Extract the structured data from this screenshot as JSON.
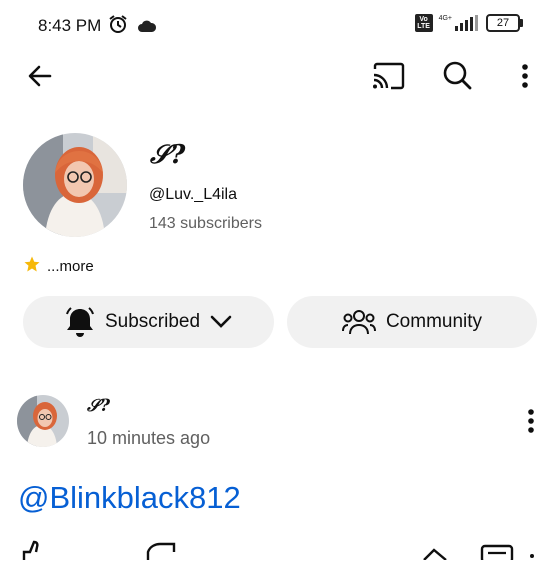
{
  "status_bar": {
    "time": "8:43 PM",
    "volte": "Vo LTE",
    "network": "4G+",
    "battery": "27"
  },
  "channel": {
    "name": "𝒮?",
    "handle": "@Luv._L4ila",
    "subscribers": "143 subscribers",
    "description_more": "...more"
  },
  "buttons": {
    "subscribed": "Subscribed",
    "community": "Community"
  },
  "post": {
    "author": "𝒮?",
    "time": "10 minutes ago",
    "text": "@Blinkblack812"
  },
  "colors": {
    "link": "#065fd4",
    "secondary_text": "#606060",
    "pill_bg": "#f1f1f1"
  },
  "icons": [
    "back-arrow-icon",
    "cast-icon",
    "search-icon",
    "more-vert-icon",
    "bell-icon",
    "chevron-down-icon",
    "people-icon",
    "star-icon",
    "like-icon",
    "dislike-icon",
    "share-icon",
    "comment-icon"
  ]
}
